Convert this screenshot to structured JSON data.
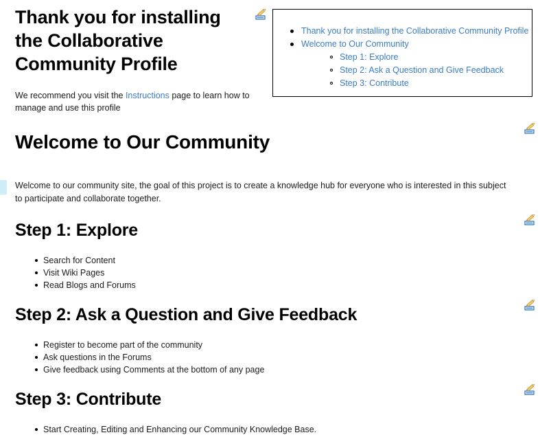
{
  "page": {
    "title": "Thank you for installing the Collaborative Community Profile",
    "intro_before_link": "We recommend you visit the ",
    "intro_link": "Instructions",
    "intro_after_link": " page to learn how to manage and use this profile"
  },
  "toc": {
    "items": [
      {
        "label": "Thank you for installing the Collaborative Community Profile"
      },
      {
        "label": "Welcome to Our Community"
      }
    ],
    "subitems": [
      {
        "label": "Step 1: Explore"
      },
      {
        "label": "Step 2: Ask a Question and Give Feedback"
      },
      {
        "label": "Step 3: Contribute"
      }
    ]
  },
  "sections": {
    "welcome": {
      "heading": "Welcome to Our Community",
      "paragraph": "Welcome to our community site, the goal of this project is to create a knowledge hub for everyone who is interested in this subject to participate and collaborate together."
    },
    "step1": {
      "heading": "Step 1: Explore",
      "items": [
        "Search for Content",
        "Visit Wiki Pages",
        "Read Blogs and Forums"
      ]
    },
    "step2": {
      "heading": "Step 2: Ask a Question and Give Feedback",
      "items": [
        "Register to become part of the community",
        "Ask questions in the Forums",
        "Give feedback using Comments at the bottom of any page"
      ]
    },
    "step3": {
      "heading": "Step 3: Contribute",
      "items": [
        "Start Creating, Editing and Enhancing our Community Knowledge Base."
      ]
    }
  },
  "icons": {
    "edit": "edit-pencil-icon"
  },
  "colors": {
    "link": "#3b7dc4",
    "text": "#1a1a1a",
    "heading": "#000000",
    "toc_border": "#000000",
    "marker": "#cdeef8",
    "pencil": "#f0c55a",
    "tray": "#3b7dc4"
  }
}
